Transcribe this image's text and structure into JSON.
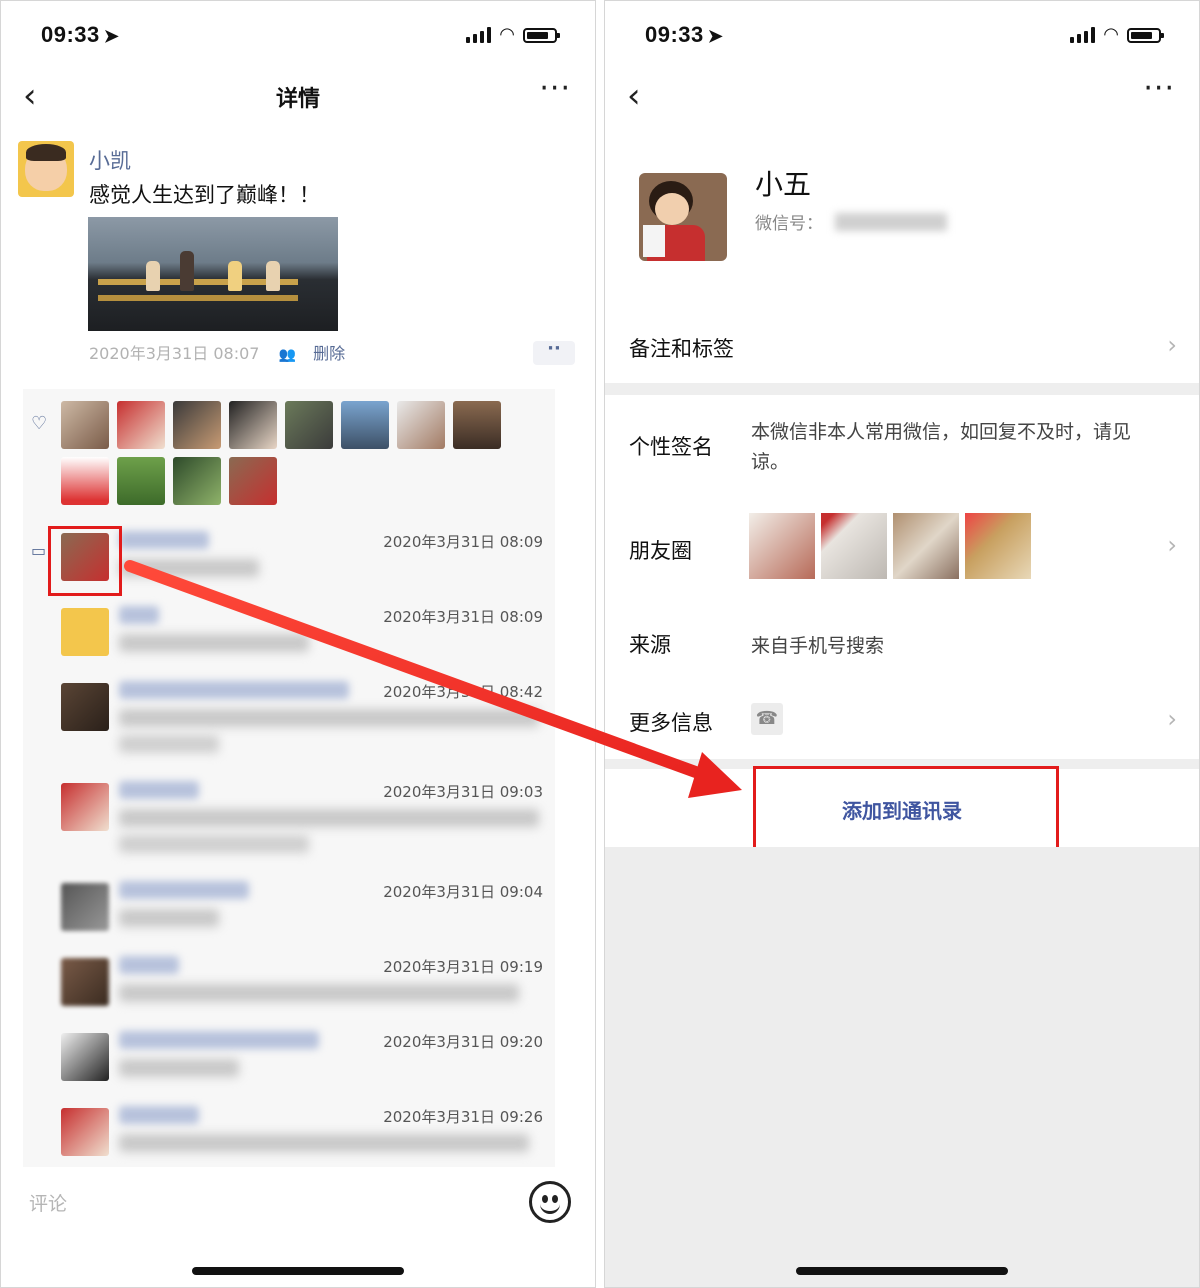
{
  "status": {
    "time": "09:33"
  },
  "left": {
    "nav": {
      "title": "详情"
    },
    "post": {
      "author": "小凯",
      "text": "感觉人生达到了巅峰！！",
      "timestamp": "2020年3月31日 08:07",
      "delete_label": "删除"
    },
    "comments": [
      {
        "time": "2020年3月31日 08:09"
      },
      {
        "time": "2020年3月31日 08:09"
      },
      {
        "time": "2020年3月31日 08:42"
      },
      {
        "time": "2020年3月31日 09:03"
      },
      {
        "time": "2020年3月31日 09:04"
      },
      {
        "time": "2020年3月31日 09:19"
      },
      {
        "time": "2020年3月31日 09:20"
      },
      {
        "time": "2020年3月31日 09:26"
      }
    ],
    "input": {
      "placeholder": "评论"
    }
  },
  "right": {
    "profile": {
      "name": "小五",
      "wechat_id_label": "微信号："
    },
    "rows": {
      "remarks": "备注和标签",
      "signature_label": "个性签名",
      "signature_text": "本微信非本人常用微信，如回复不及时，请见谅。",
      "moments_label": "朋友圈",
      "source_label": "来源",
      "source_text": "来自手机号搜索",
      "more_info_label": "更多信息"
    },
    "add_button": "添加到通讯录"
  },
  "colors": {
    "link": "#576b95",
    "highlight": "#e21b1b",
    "add_button": "#3f55a0"
  }
}
